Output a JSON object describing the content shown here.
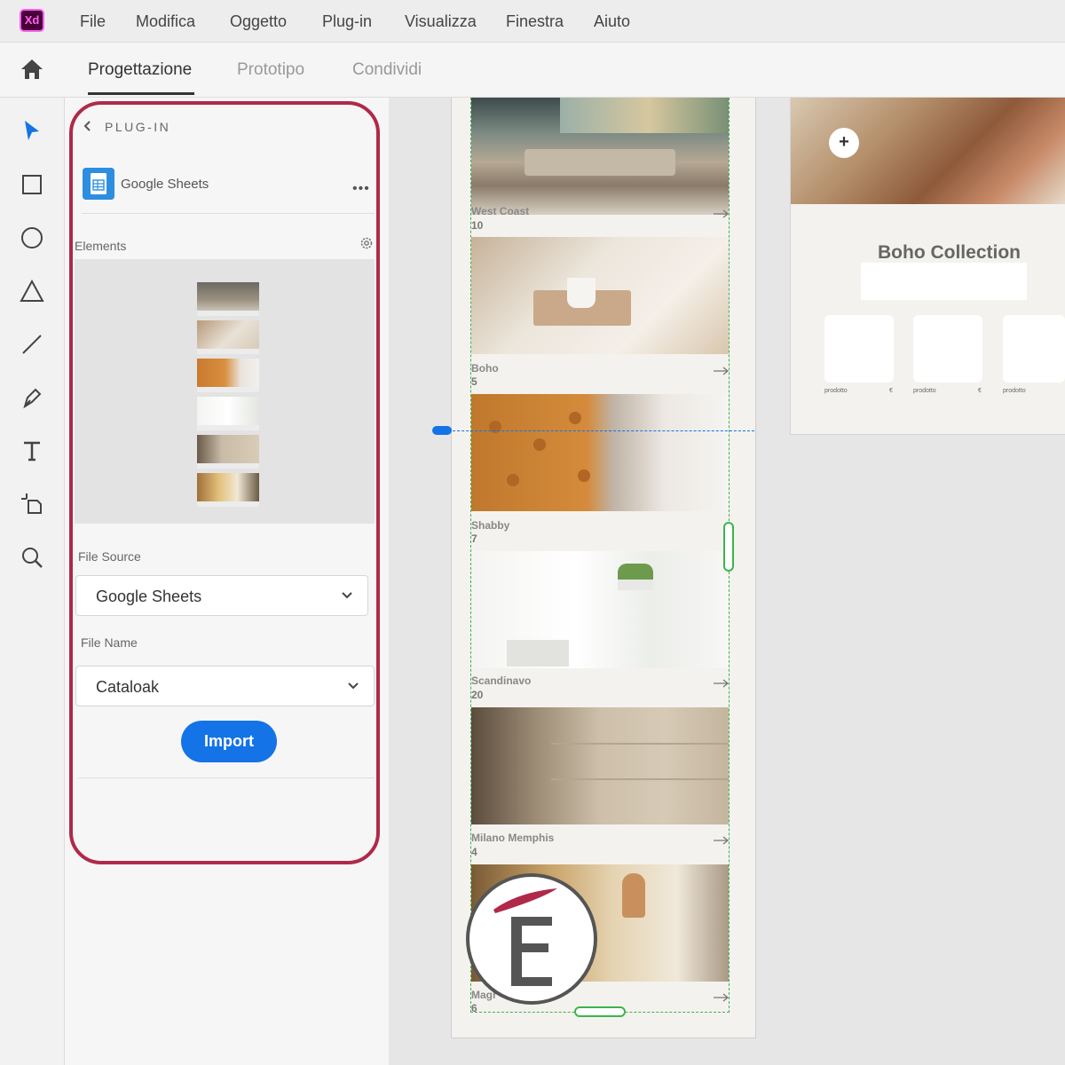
{
  "app": {
    "logo": "Xd",
    "menu": [
      "File",
      "Modifica",
      "Oggetto",
      "Plug-in",
      "Visualizza",
      "Finestra",
      "Aiuto"
    ]
  },
  "tabs": {
    "items": [
      "Progettazione",
      "Prototipo",
      "Condividi"
    ],
    "active": "Progettazione"
  },
  "toolbar": {
    "tools": [
      "select-tool",
      "rectangle-tool",
      "ellipse-tool",
      "polygon-tool",
      "line-tool",
      "pen-tool",
      "text-tool",
      "artboard-tool",
      "zoom-tool"
    ]
  },
  "panel": {
    "header": "PLUG-IN",
    "plugin_name": "Google Sheets",
    "more_label": "•••",
    "elements_label": "Elements",
    "file_source_label": "File Source",
    "file_source_value": "Google Sheets",
    "file_name_label": "File Name",
    "file_name_value": "Cataloak",
    "import_label": "Import"
  },
  "canvas": {
    "cards": [
      {
        "title": "West Coast",
        "count": "10"
      },
      {
        "title": "Boho",
        "count": "5"
      },
      {
        "title": "Shabby",
        "count": "7"
      },
      {
        "title": "Scandinavo",
        "count": "20"
      },
      {
        "title": "Milano Memphis",
        "count": "4"
      },
      {
        "title": "Magr",
        "count": "6"
      }
    ],
    "artboard2": {
      "title": "Boho Collection",
      "add_label": "+",
      "products": [
        {
          "label": "prodotto",
          "price": "€"
        },
        {
          "label": "prodotto",
          "price": "€"
        },
        {
          "label": "prodotto",
          "price": ""
        }
      ]
    }
  },
  "colors": {
    "accent": "#1473e6",
    "highlight": "#b0294a",
    "guide_green": "#3cb44b"
  }
}
